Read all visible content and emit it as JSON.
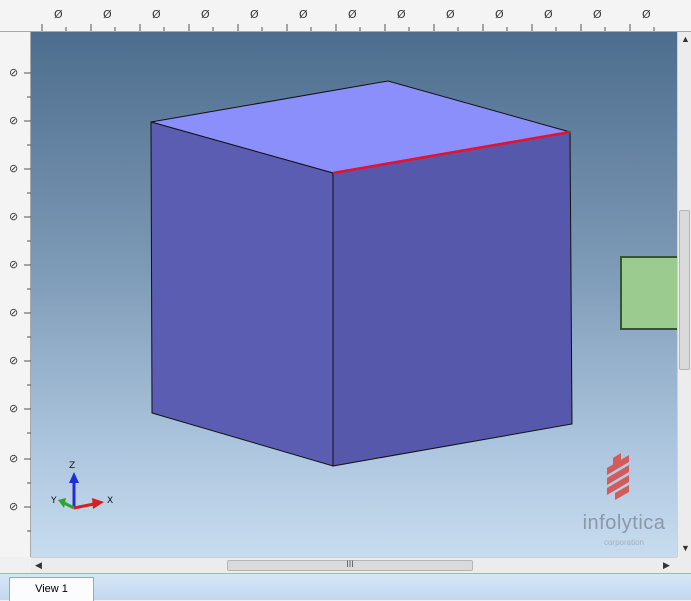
{
  "rulers": {
    "top_labels": [
      "Ø",
      "Ø",
      "Ø",
      "Ø",
      "Ø",
      "Ø",
      "Ø",
      "Ø",
      "Ø",
      "Ø",
      "Ø",
      "Ø",
      "Ø"
    ],
    "left_labels": [
      "⊘",
      "⊘",
      "⊘",
      "⊘",
      "⊘",
      "⊘",
      "⊘",
      "⊘",
      "⊘",
      "⊘"
    ]
  },
  "axes": {
    "z": "Z",
    "y": "Y",
    "x": "X"
  },
  "colors": {
    "cube_top": "#8b8ffb",
    "cube_left": "#5a5db1",
    "cube_right": "#5558ab",
    "selected_edge": "#e8102a",
    "axis_x": "#d42020",
    "axis_y": "#2fa52f",
    "axis_z": "#1c2fd8"
  },
  "logo": {
    "name": "infolytica",
    "sub": "corporation"
  },
  "scrollbar": {
    "grip": "III"
  },
  "tabs": [
    {
      "label": "View 1"
    }
  ]
}
